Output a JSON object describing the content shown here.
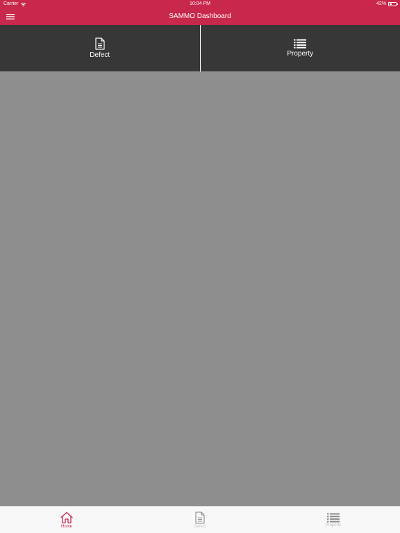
{
  "status_bar": {
    "carrier": "Carrier",
    "time": "10:04 PM",
    "battery": "42%",
    "battery_level": 0.42
  },
  "header": {
    "title": "SAMMO Dashboard"
  },
  "tiles": [
    {
      "label": "Defect",
      "icon": "document-icon"
    },
    {
      "label": "Property",
      "icon": "list-icon"
    }
  ],
  "tab_bar": {
    "tabs": [
      {
        "label": "Home",
        "icon": "home-icon",
        "active": true
      },
      {
        "label": "Defect",
        "icon": "document-icon",
        "active": false
      },
      {
        "label": "Property",
        "icon": "list-icon",
        "active": false
      }
    ]
  },
  "colors": {
    "accent": "#c8284b",
    "tile_background": "#373737",
    "content_background": "#8e8e8e",
    "tab_bar_background": "#f8f8f8",
    "tab_inactive": "#c4c4c4"
  }
}
